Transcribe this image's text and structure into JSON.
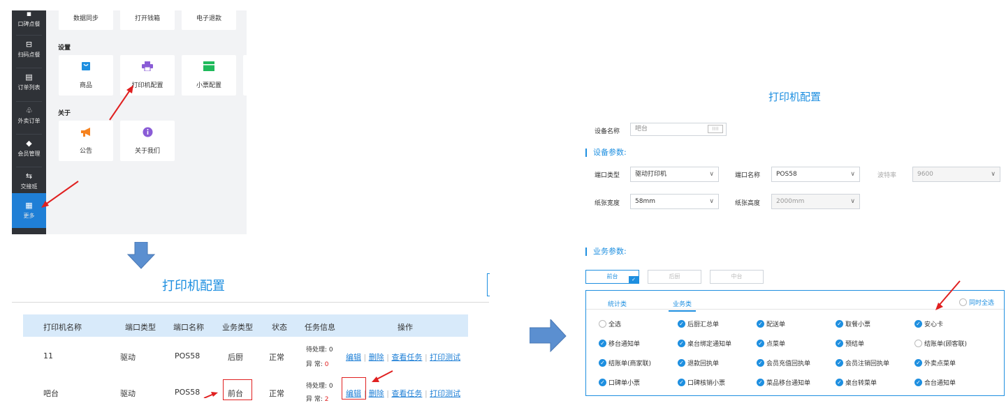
{
  "sidebar": {
    "items": [
      {
        "label": "口碑点餐",
        "icon": "koubei-icon"
      },
      {
        "label": "扫码点餐",
        "icon": "scan-icon"
      },
      {
        "label": "订单列表",
        "icon": "order-list-icon"
      },
      {
        "label": "外卖订单",
        "icon": "takeout-icon"
      },
      {
        "label": "会员管理",
        "icon": "member-icon"
      },
      {
        "label": "交接班",
        "icon": "shift-icon"
      },
      {
        "label": "更多",
        "icon": "more-grid-icon"
      }
    ]
  },
  "more_page": {
    "top_tiles": [
      "数据同步",
      "打开钱箱",
      "电子退款"
    ],
    "section_settings": "设置",
    "settings_tiles": [
      {
        "label": "商品",
        "icon": "bag-icon",
        "color": "#1e8fe0"
      },
      {
        "label": "打印机配置",
        "icon": "printer-icon",
        "color": "#8a5cd6"
      },
      {
        "label": "小票配置",
        "icon": "folder-icon",
        "color": "#1fba5b"
      }
    ],
    "section_about": "关于",
    "about_tiles": [
      {
        "label": "公告",
        "icon": "megaphone-icon",
        "color": "#f5821f"
      },
      {
        "label": "关于我们",
        "icon": "info-icon",
        "color": "#8a5cd6"
      }
    ]
  },
  "printer_list": {
    "title": "打印机配置",
    "columns": [
      "打印机名称",
      "端口类型",
      "端口名称",
      "业务类型",
      "状态",
      "任务信息",
      "操作"
    ],
    "rows": [
      {
        "name": "11",
        "port_type": "驱动",
        "port_name": "POS58",
        "biz_type": "后厨",
        "status": "正常",
        "pending_label": "待处理:",
        "pending": "0",
        "error_label": "异 常:",
        "error": "0"
      },
      {
        "name": "吧台",
        "port_type": "驱动",
        "port_name": "POS58",
        "biz_type": "前台",
        "status": "正常",
        "pending_label": "待处理:",
        "pending": "0",
        "error_label": "异 常:",
        "error": "2"
      }
    ],
    "actions": [
      "编辑",
      "删除",
      "查看任务",
      "打印测试"
    ]
  },
  "config": {
    "title": "打印机配置",
    "device_name_label": "设备名称",
    "device_name_value": "吧台",
    "device_params_title": "设备参数:",
    "port_type_label": "端口类型",
    "port_type_value": "驱动打印机",
    "port_name_label": "端口名称",
    "port_name_value": "POS58",
    "baud_label": "波特率",
    "baud_value": "9600",
    "paper_width_label": "纸张宽度",
    "paper_width_value": "58mm",
    "paper_height_label": "纸张高度",
    "paper_height_value": "2000mm",
    "biz_params_title": "业务参数:",
    "biz_tabs": [
      "前台",
      "后厨",
      "中台"
    ],
    "sub_tabs": [
      "统计类",
      "业务类"
    ],
    "select_all_right": "同时全选",
    "options": [
      {
        "label": "全选",
        "checked": false
      },
      {
        "label": "后厨汇总单",
        "checked": true
      },
      {
        "label": "配送单",
        "checked": true
      },
      {
        "label": "取餐小票",
        "checked": true
      },
      {
        "label": "安心卡",
        "checked": true
      },
      {
        "label": "移台通知单",
        "checked": true
      },
      {
        "label": "桌台绑定通知单",
        "checked": true
      },
      {
        "label": "点菜单",
        "checked": true
      },
      {
        "label": "预结单",
        "checked": true
      },
      {
        "label": "结账单(顾客联)",
        "checked": false
      },
      {
        "label": "结账单(商家联)",
        "checked": true
      },
      {
        "label": "退款回执单",
        "checked": true
      },
      {
        "label": "会员充值回执单",
        "checked": true
      },
      {
        "label": "会员注销回执单",
        "checked": true
      },
      {
        "label": "外卖点菜单",
        "checked": true
      },
      {
        "label": "口碑单小票",
        "checked": true
      },
      {
        "label": "口碑核销小票",
        "checked": true
      },
      {
        "label": "菜品移台通知单",
        "checked": true
      },
      {
        "label": "桌台转菜单",
        "checked": true
      },
      {
        "label": "合台通知单",
        "checked": true
      }
    ]
  },
  "colors": {
    "accent": "#1e8fe0",
    "annotation_red": "#e02020",
    "arrow_blue": "#5b8fd0"
  }
}
